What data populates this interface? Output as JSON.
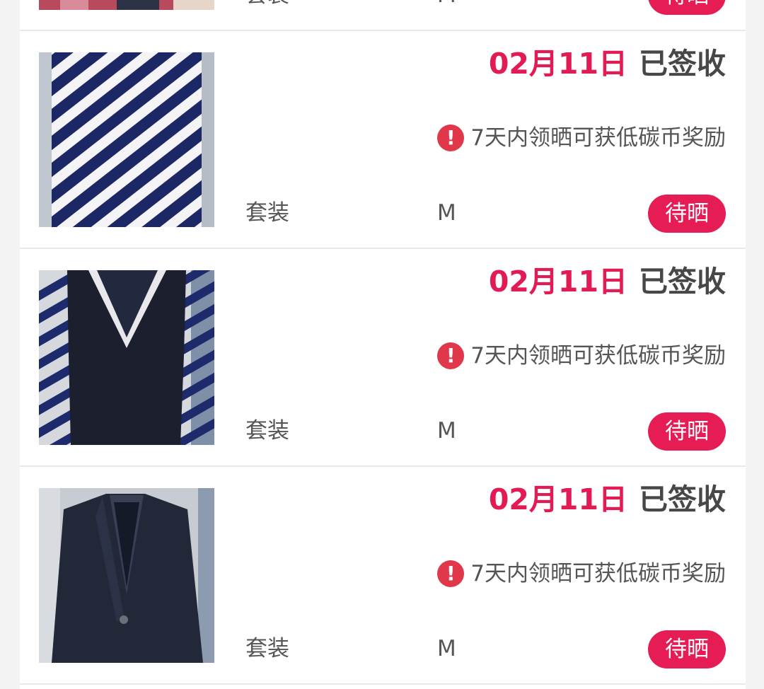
{
  "colors": {
    "accent": "#e61c55",
    "date": "#e21b55",
    "status_text": "#474747",
    "alert_icon": "#e0374a",
    "body_text": "#555555"
  },
  "orders": [
    {
      "date": "",
      "status": "",
      "hint": "",
      "category": "套装",
      "size": "M",
      "action": "待晒",
      "thumb_icon": "floral-garment-photo"
    },
    {
      "date": "02月11日",
      "status": "已签收",
      "hint": "7天内领晒可获低碳币奖励",
      "alert_icon": "!",
      "category": "套装",
      "size": "M",
      "action": "待晒",
      "thumb_icon": "striped-blouse-photo"
    },
    {
      "date": "02月11日",
      "status": "已签收",
      "hint": "7天内领晒可获低碳币奖励",
      "alert_icon": "!",
      "category": "套装",
      "size": "M",
      "action": "待晒",
      "thumb_icon": "navy-dress-photo"
    },
    {
      "date": "02月11日",
      "status": "已签收",
      "hint": "7天内领晒可获低碳币奖励",
      "alert_icon": "!",
      "category": "套装",
      "size": "M",
      "action": "待晒",
      "thumb_icon": "navy-blazer-photo"
    }
  ]
}
